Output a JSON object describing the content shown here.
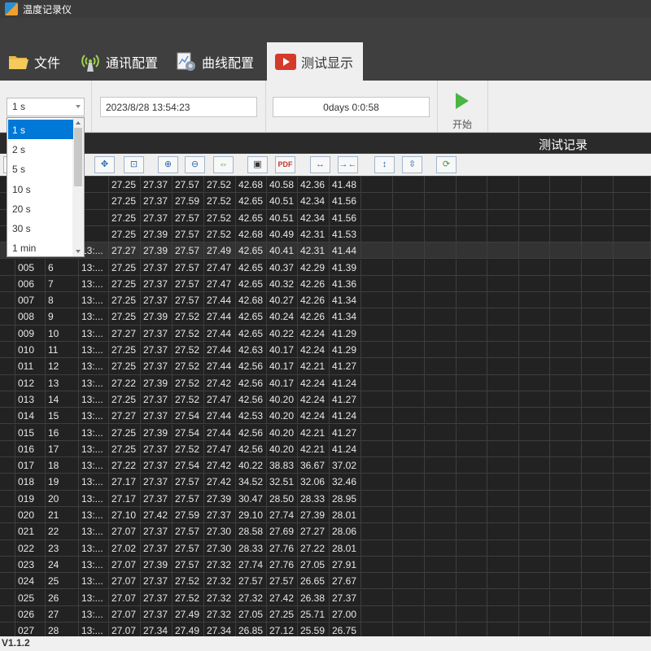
{
  "window": {
    "title": "温度记录仪"
  },
  "tabs": [
    {
      "label": "文件",
      "icon": "folder-icon"
    },
    {
      "label": "通讯配置",
      "icon": "antenna-icon"
    },
    {
      "label": "曲线配置",
      "icon": "gear-chart-icon"
    },
    {
      "label": "测试显示",
      "icon": "play-video-icon",
      "active": true
    }
  ],
  "controls": {
    "interval_value": "1 s",
    "datetime": "2023/8/28 13:54:23",
    "elapsed": "0days  0:0:58",
    "start_label": "开始"
  },
  "records_title": "测试记录",
  "toolbar_icons": [
    "fit-view-icon",
    "zoom-box-icon",
    "zoom-in-icon",
    "zoom-out-icon",
    "pan-icon",
    "save-icon",
    "pdf-icon",
    "expand-horizontal-icon",
    "compress-horizontal-icon",
    "expand-vertical-icon",
    "compress-vertical-icon",
    "refresh-icon"
  ],
  "dropdown": {
    "options": [
      "1 s",
      "2 s",
      "5 s",
      "10 s",
      "20 s",
      "30 s",
      "1 min"
    ],
    "selected_index": 0
  },
  "table": {
    "rows": [
      [
        "",
        "",
        "",
        "27.25",
        "27.37",
        "27.57",
        "27.52",
        "42.68",
        "40.58",
        "42.36",
        "41.48"
      ],
      [
        "",
        "",
        "",
        "27.25",
        "27.37",
        "27.59",
        "27.52",
        "42.65",
        "40.51",
        "42.34",
        "41.56"
      ],
      [
        "",
        "",
        "",
        "27.25",
        "27.37",
        "27.57",
        "27.52",
        "42.65",
        "40.51",
        "42.34",
        "41.56"
      ],
      [
        "",
        "",
        "",
        "27.25",
        "27.39",
        "27.57",
        "27.52",
        "42.68",
        "40.49",
        "42.31",
        "41.53"
      ],
      [
        "",
        "",
        "13:...",
        "27.27",
        "27.39",
        "27.57",
        "27.49",
        "42.65",
        "40.41",
        "42.31",
        "41.44"
      ],
      [
        "005",
        "6",
        "13:...",
        "27.25",
        "27.37",
        "27.57",
        "27.47",
        "42.65",
        "40.37",
        "42.29",
        "41.39"
      ],
      [
        "006",
        "7",
        "13:...",
        "27.25",
        "27.37",
        "27.57",
        "27.47",
        "42.65",
        "40.32",
        "42.26",
        "41.36"
      ],
      [
        "007",
        "8",
        "13:...",
        "27.25",
        "27.37",
        "27.57",
        "27.44",
        "42.68",
        "40.27",
        "42.26",
        "41.34"
      ],
      [
        "008",
        "9",
        "13:...",
        "27.25",
        "27.39",
        "27.52",
        "27.44",
        "42.65",
        "40.24",
        "42.26",
        "41.34"
      ],
      [
        "009",
        "10",
        "13:...",
        "27.27",
        "27.37",
        "27.52",
        "27.44",
        "42.65",
        "40.22",
        "42.24",
        "41.29"
      ],
      [
        "010",
        "11",
        "13:...",
        "27.25",
        "27.37",
        "27.52",
        "27.44",
        "42.63",
        "40.17",
        "42.24",
        "41.29"
      ],
      [
        "011",
        "12",
        "13:...",
        "27.25",
        "27.37",
        "27.52",
        "27.44",
        "42.56",
        "40.17",
        "42.21",
        "41.27"
      ],
      [
        "012",
        "13",
        "13:...",
        "27.22",
        "27.39",
        "27.52",
        "27.42",
        "42.56",
        "40.17",
        "42.24",
        "41.24"
      ],
      [
        "013",
        "14",
        "13:...",
        "27.25",
        "27.37",
        "27.52",
        "27.47",
        "42.56",
        "40.20",
        "42.24",
        "41.27"
      ],
      [
        "014",
        "15",
        "13:...",
        "27.27",
        "27.37",
        "27.54",
        "27.44",
        "42.53",
        "40.20",
        "42.24",
        "41.24"
      ],
      [
        "015",
        "16",
        "13:...",
        "27.25",
        "27.39",
        "27.54",
        "27.44",
        "42.56",
        "40.20",
        "42.21",
        "41.27"
      ],
      [
        "016",
        "17",
        "13:...",
        "27.25",
        "27.37",
        "27.52",
        "27.47",
        "42.56",
        "40.20",
        "42.21",
        "41.24"
      ],
      [
        "017",
        "18",
        "13:...",
        "27.22",
        "27.37",
        "27.54",
        "27.42",
        "40.22",
        "38.83",
        "36.67",
        "37.02"
      ],
      [
        "018",
        "19",
        "13:...",
        "27.17",
        "27.37",
        "27.57",
        "27.42",
        "34.52",
        "32.51",
        "32.06",
        "32.46"
      ],
      [
        "019",
        "20",
        "13:...",
        "27.17",
        "27.37",
        "27.57",
        "27.39",
        "30.47",
        "28.50",
        "28.33",
        "28.95"
      ],
      [
        "020",
        "21",
        "13:...",
        "27.10",
        "27.42",
        "27.59",
        "27.37",
        "29.10",
        "27.74",
        "27.39",
        "28.01"
      ],
      [
        "021",
        "22",
        "13:...",
        "27.07",
        "27.37",
        "27.57",
        "27.30",
        "28.58",
        "27.69",
        "27.27",
        "28.06"
      ],
      [
        "022",
        "23",
        "13:...",
        "27.02",
        "27.37",
        "27.57",
        "27.30",
        "28.33",
        "27.76",
        "27.22",
        "28.01"
      ],
      [
        "023",
        "24",
        "13:...",
        "27.07",
        "27.39",
        "27.57",
        "27.32",
        "27.74",
        "27.76",
        "27.05",
        "27.91"
      ],
      [
        "024",
        "25",
        "13:...",
        "27.07",
        "27.37",
        "27.52",
        "27.32",
        "27.57",
        "27.57",
        "26.65",
        "27.67"
      ],
      [
        "025",
        "26",
        "13:...",
        "27.07",
        "27.37",
        "27.52",
        "27.32",
        "27.32",
        "27.42",
        "26.38",
        "27.37"
      ],
      [
        "026",
        "27",
        "13:...",
        "27.07",
        "27.37",
        "27.49",
        "27.32",
        "27.05",
        "27.25",
        "25.71",
        "27.00"
      ],
      [
        "027",
        "28",
        "13:...",
        "27.07",
        "27.34",
        "27.49",
        "27.34",
        "26.85",
        "27.12",
        "25.59",
        "26.75"
      ]
    ],
    "selected_row": 4
  },
  "status": {
    "version": "V1.1.2"
  },
  "colors": {
    "window_bg": "#3f3f3f",
    "grid_bg": "#222222",
    "grid_line": "#3e3e3e",
    "panel_bg": "#efefef",
    "selection_blue": "#0078d7",
    "play_green": "#4ab542"
  }
}
